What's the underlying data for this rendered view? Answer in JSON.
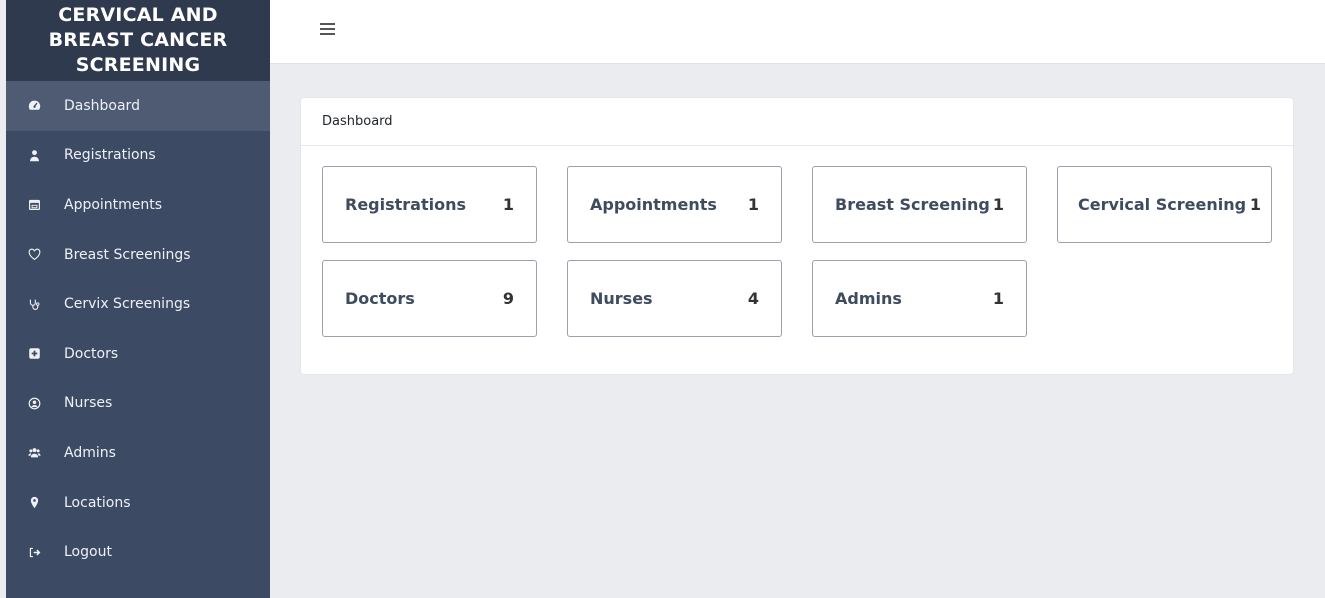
{
  "brand": {
    "title": "CERVICAL AND BREAST CANCER SCREENING"
  },
  "sidebar": {
    "items": [
      {
        "label": "Dashboard",
        "icon": "dashboard-icon",
        "active": true
      },
      {
        "label": "Registrations",
        "icon": "user-icon"
      },
      {
        "label": "Appointments",
        "icon": "calendar-icon"
      },
      {
        "label": "Breast Screenings",
        "icon": "heart-icon"
      },
      {
        "label": "Cervix Screenings",
        "icon": "stethoscope-icon"
      },
      {
        "label": "Doctors",
        "icon": "medical-plus-icon"
      },
      {
        "label": "Nurses",
        "icon": "user-circle-icon"
      },
      {
        "label": "Admins",
        "icon": "users-icon"
      },
      {
        "label": "Locations",
        "icon": "map-marker-icon"
      },
      {
        "label": "Logout",
        "icon": "sign-out-icon"
      }
    ]
  },
  "topbar": {
    "menu_icon": "hamburger-icon"
  },
  "card": {
    "title": "Dashboard",
    "tiles": [
      {
        "label": "Registrations",
        "count": "1"
      },
      {
        "label": "Appointments",
        "count": "1"
      },
      {
        "label": "Breast Screening",
        "count": "1"
      },
      {
        "label": "Cervical Screening",
        "count": "1"
      },
      {
        "label": "Doctors",
        "count": "9"
      },
      {
        "label": "Nurses",
        "count": "4"
      },
      {
        "label": "Admins",
        "count": "1"
      }
    ]
  },
  "colors": {
    "sidebar": "#3d4a63",
    "brand_bg": "#2f3a4f",
    "active_item": "#4e5b73",
    "page_bg": "#ebecef"
  }
}
